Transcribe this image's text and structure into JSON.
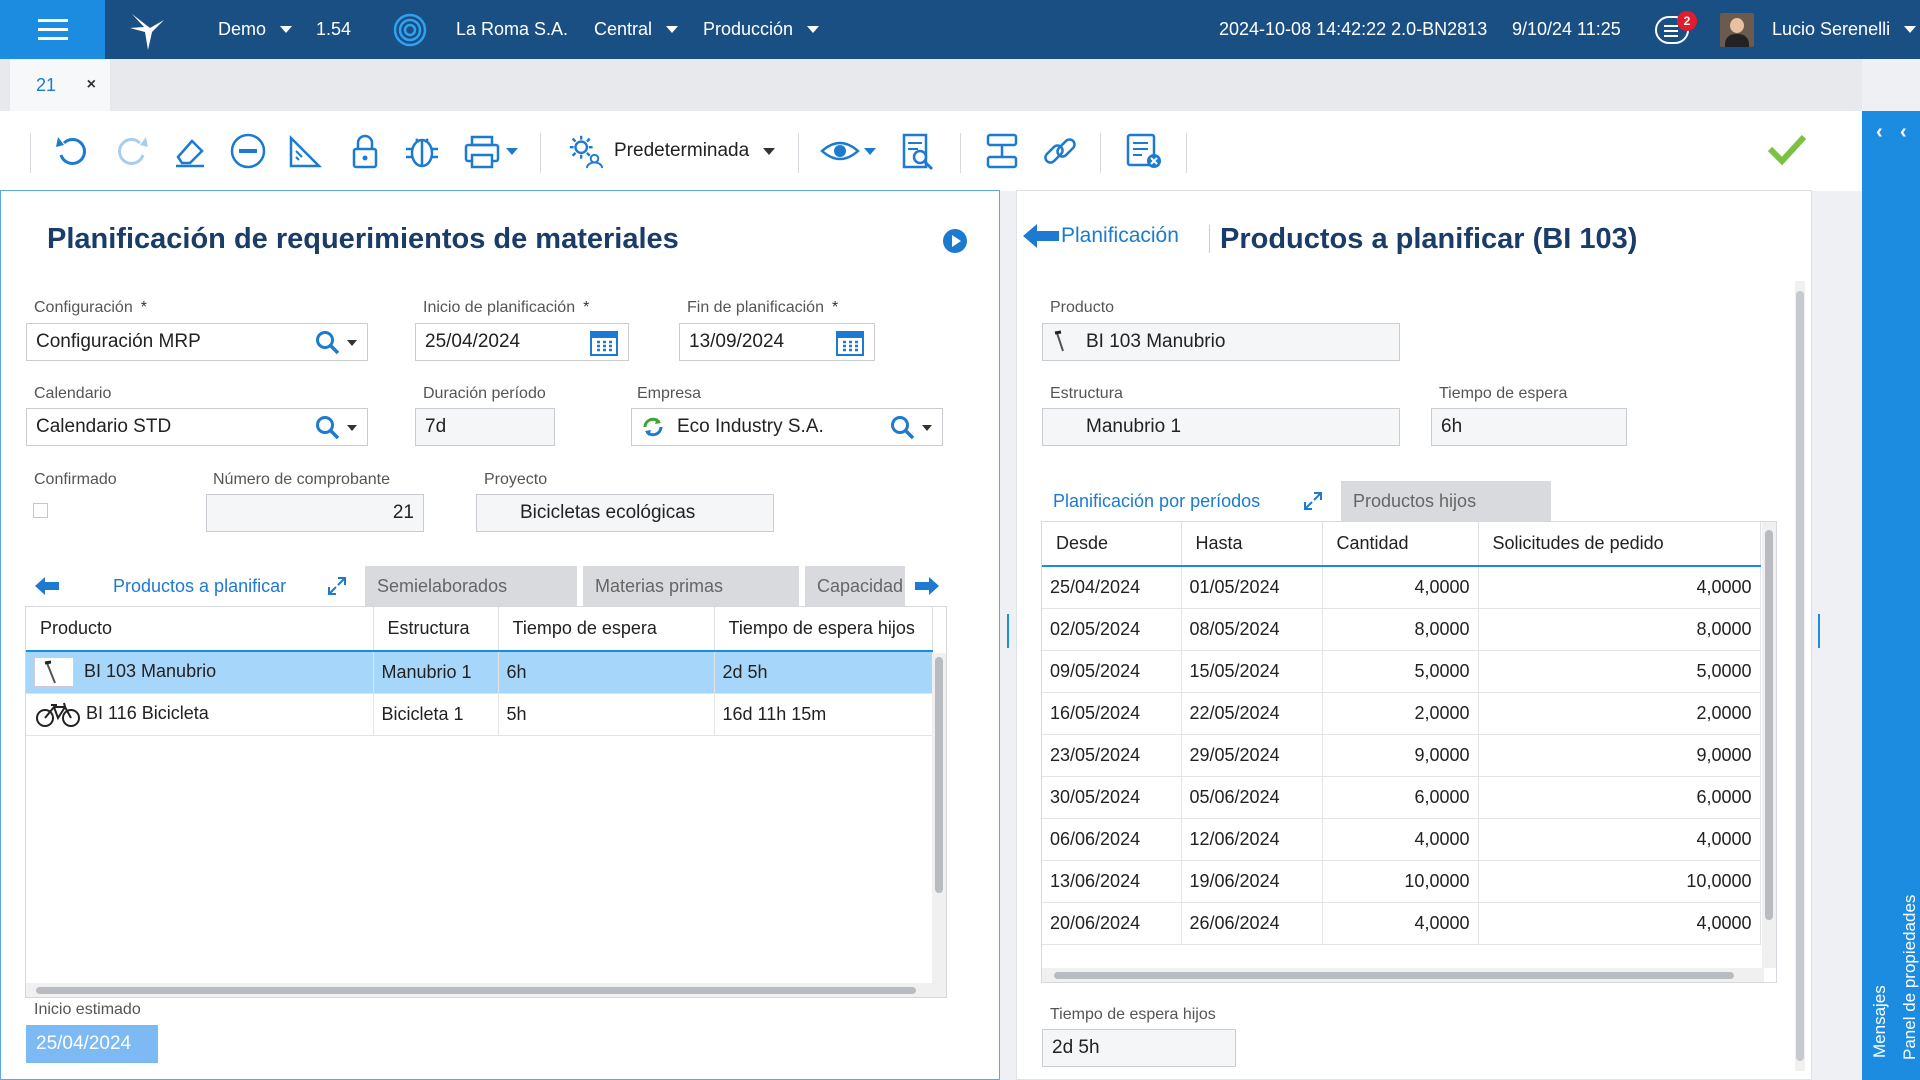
{
  "topbar": {
    "company_mode": "Demo",
    "version": "1.54",
    "company": "La Roma S.A.",
    "branch": "Central",
    "environment": "Producción",
    "build": "2024-10-08 14:42:22 2.0-BN2813",
    "datetime": "9/10/24 11:25",
    "notifications": "2",
    "user": "Lucio Serenelli"
  },
  "tabs": {
    "doc_tab": "21",
    "close": "×"
  },
  "toolbar": {
    "layout_label": "Predeterminada"
  },
  "rail": {
    "panel_label": "Panel de propiedades",
    "messages_label": "Mensajes"
  },
  "left": {
    "title": "Planificación de requerimientos de materiales",
    "configuracion": {
      "label": "Configuración",
      "value": "Configuración MRP"
    },
    "inicio": {
      "label": "Inicio de planificación",
      "value": "25/04/2024"
    },
    "fin": {
      "label": "Fin de planificación",
      "value": "13/09/2024"
    },
    "calendario": {
      "label": "Calendario",
      "value": "Calendario STD"
    },
    "duracion": {
      "label": "Duración período",
      "value": "7d"
    },
    "empresa": {
      "label": "Empresa",
      "value": "Eco Industry S.A."
    },
    "confirmado": {
      "label": "Confirmado"
    },
    "comprobante": {
      "label": "Número de comprobante",
      "value": "21"
    },
    "proyecto": {
      "label": "Proyecto",
      "value": "Bicicletas ecológicas"
    },
    "tabs": [
      "Productos a planificar",
      "Semielaborados",
      "Materias primas",
      "Capacidad"
    ],
    "grid": {
      "columns": [
        "Producto",
        "Estructura",
        "Tiempo de espera",
        "Tiempo de espera hijos"
      ],
      "rows": [
        {
          "producto": "BI 103 Manubrio",
          "estructura": "Manubrio 1",
          "espera": "6h",
          "espera_hijos": "2d 5h"
        },
        {
          "producto": "BI 116 Bicicleta",
          "estructura": "Bicicleta 1",
          "espera": "5h",
          "espera_hijos": "16d 11h 15m"
        }
      ]
    },
    "inicio_estimado": {
      "label": "Inicio estimado",
      "value": "25/04/2024"
    }
  },
  "right": {
    "back_label": "Planificación",
    "title": "Productos a planificar (BI 103)",
    "producto": {
      "label": "Producto",
      "value": "BI 103 Manubrio"
    },
    "estructura": {
      "label": "Estructura",
      "value": "Manubrio 1"
    },
    "espera": {
      "label": "Tiempo de espera",
      "value": "6h"
    },
    "tabs": [
      "Planificación por períodos",
      "Productos hijos"
    ],
    "grid": {
      "columns": [
        "Desde",
        "Hasta",
        "Cantidad",
        "Solicitudes de pedido"
      ],
      "rows": [
        [
          "25/04/2024",
          "01/05/2024",
          "4,0000",
          "4,0000"
        ],
        [
          "02/05/2024",
          "08/05/2024",
          "8,0000",
          "8,0000"
        ],
        [
          "09/05/2024",
          "15/05/2024",
          "5,0000",
          "5,0000"
        ],
        [
          "16/05/2024",
          "22/05/2024",
          "2,0000",
          "2,0000"
        ],
        [
          "23/05/2024",
          "29/05/2024",
          "9,0000",
          "9,0000"
        ],
        [
          "30/05/2024",
          "05/06/2024",
          "6,0000",
          "6,0000"
        ],
        [
          "06/06/2024",
          "12/06/2024",
          "4,0000",
          "4,0000"
        ],
        [
          "13/06/2024",
          "19/06/2024",
          "10,0000",
          "10,0000"
        ],
        [
          "20/06/2024",
          "26/06/2024",
          "4,0000",
          "4,0000"
        ]
      ]
    },
    "espera_hijos": {
      "label": "Tiempo de espera hijos",
      "value": "2d 5h"
    }
  },
  "colors": {
    "brand_dark": "#1a4f83",
    "accent": "#1c8ce0",
    "title": "#1a3c68",
    "selection": "#a6d7fb",
    "ok": "#7cc242"
  }
}
